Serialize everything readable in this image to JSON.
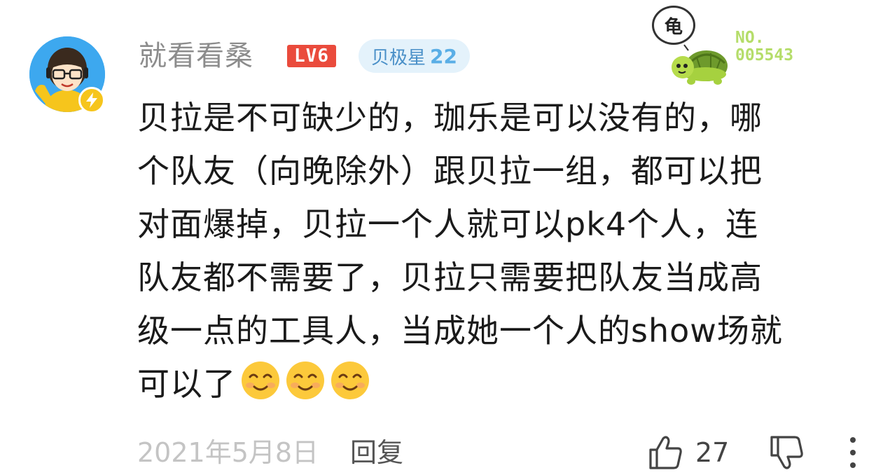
{
  "comment": {
    "username": "就看看桑",
    "level": "LV6",
    "fan_badge": {
      "name": "贝极星",
      "level": "22"
    },
    "turtle": {
      "speech": "龟",
      "number": [
        "NO.",
        "005543"
      ]
    },
    "lines": [
      "贝拉是不可缺少的，珈乐是可以没有的，哪",
      "个队友（向晚除外）跟贝拉一组，都可以把",
      "对面爆掉，贝拉一个人就可以pk4个人，连",
      "队友都不需要了，贝拉只需要把队友当成高",
      "级一点的工具人，当成她一个人的show场就",
      "可以了"
    ],
    "emojis": [
      "smile-emoji",
      "smile-emoji",
      "smile-emoji"
    ],
    "date": "2021年5月8日",
    "reply_label": "回复",
    "like_count": "27"
  },
  "colors": {
    "level_badge": "#ea4b3c",
    "fan_badge_bg": "#e4f2fb",
    "fan_badge_text": "#4a90c8",
    "turtle_green": "#b5dd6a",
    "avatar_bg": "#3da8ef"
  },
  "icons": [
    "smile-emoji",
    "lightning-icon",
    "turtle-icon",
    "thumbs-up-icon",
    "thumbs-down-icon",
    "more-icon"
  ]
}
